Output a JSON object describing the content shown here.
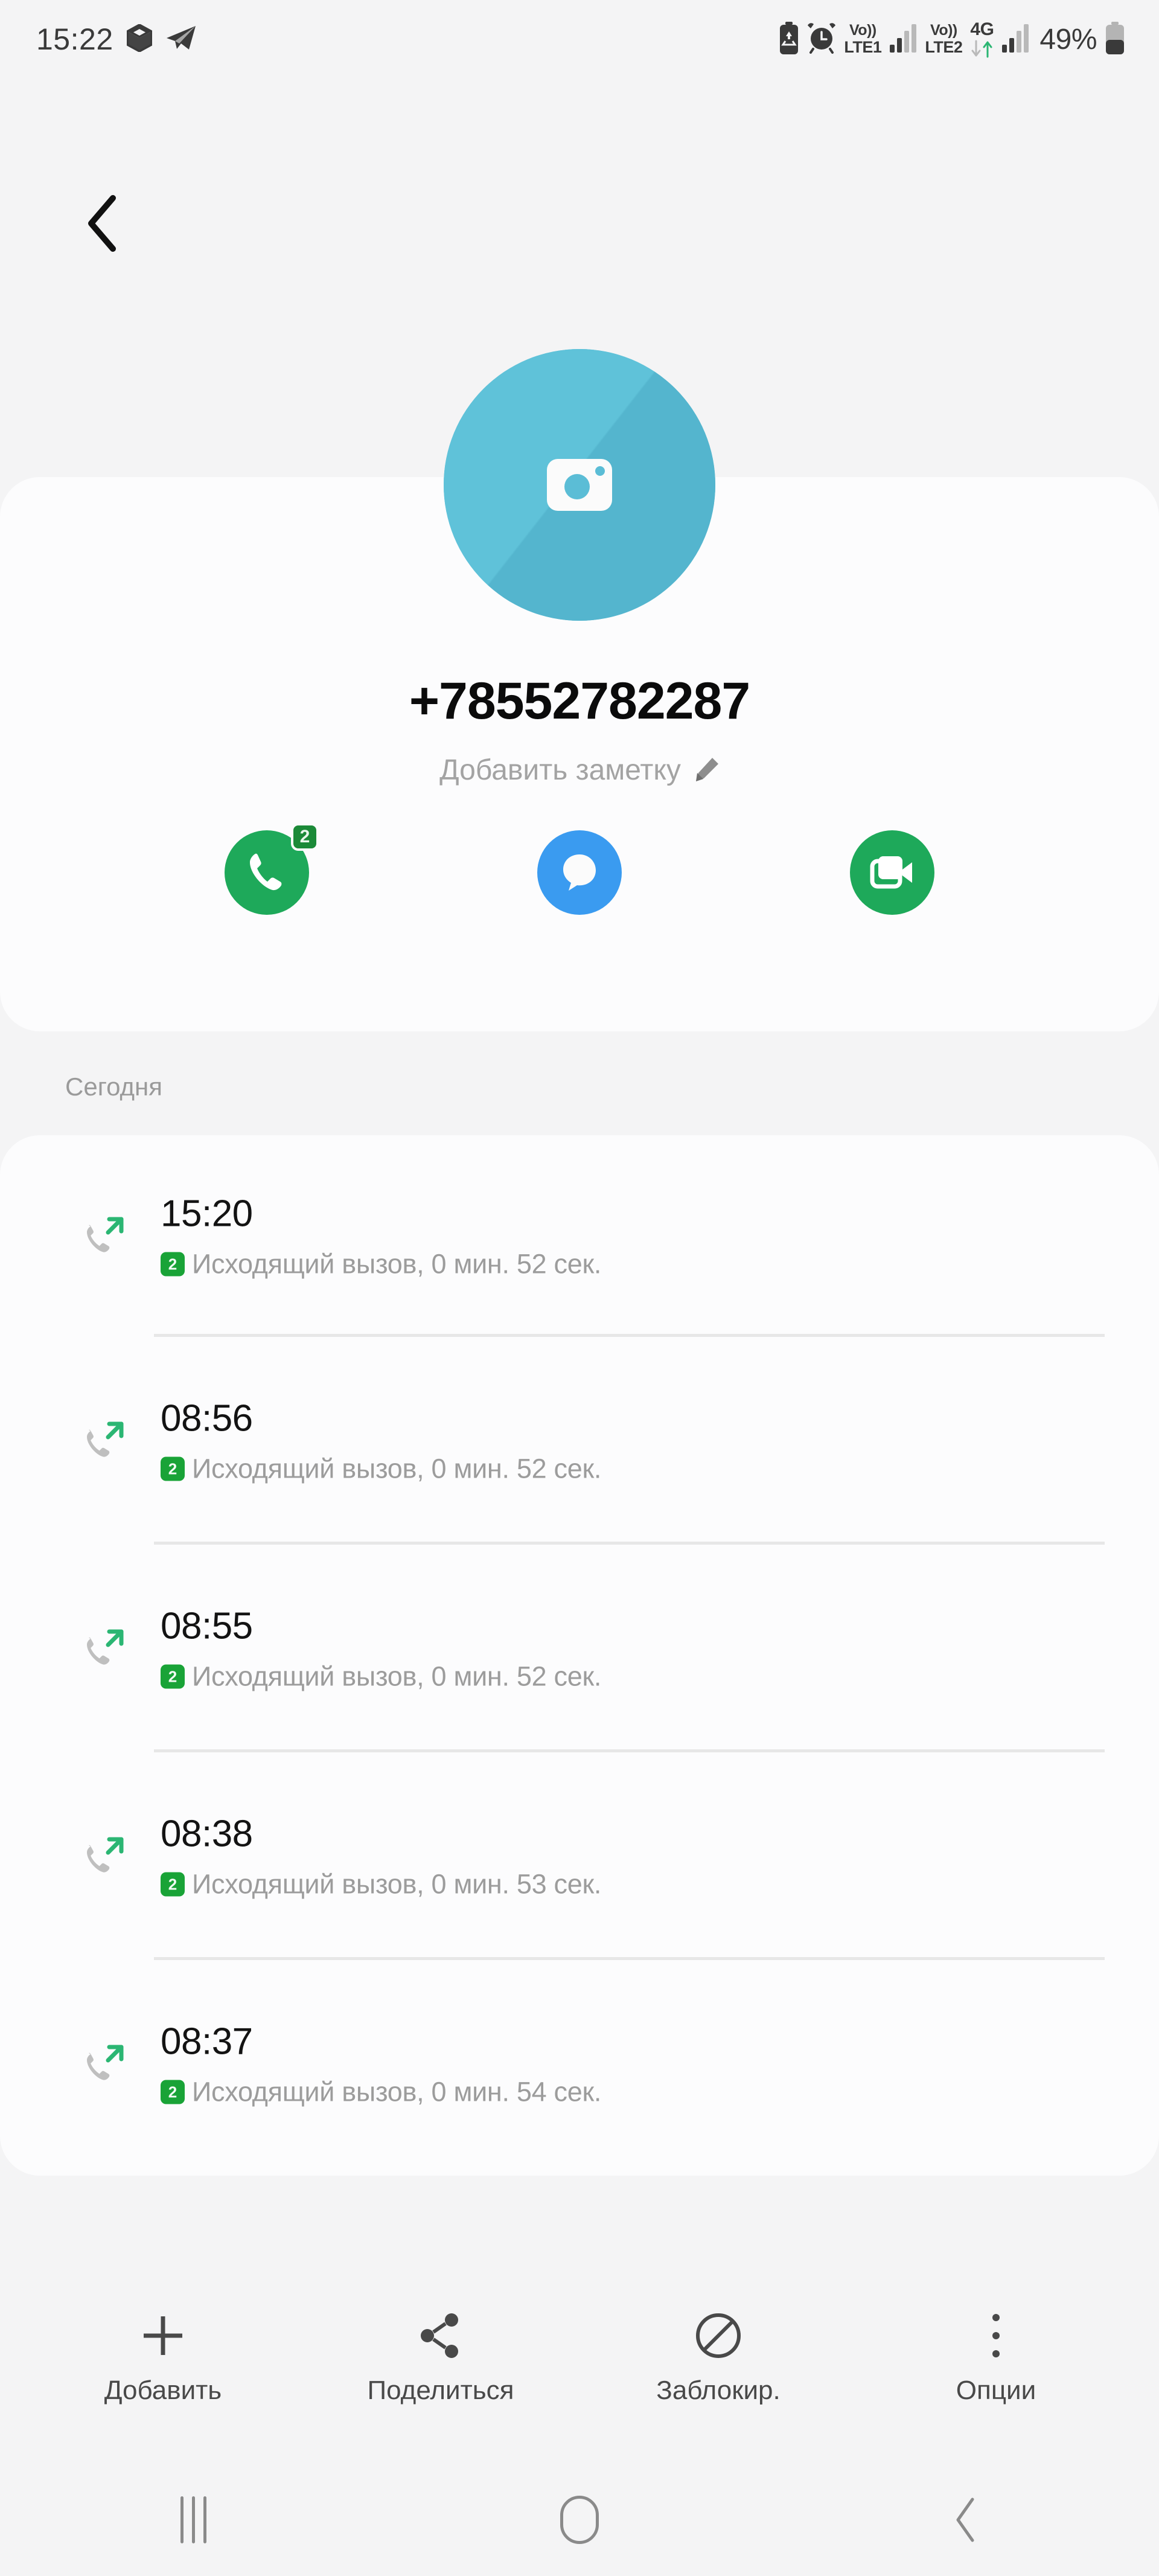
{
  "status_bar": {
    "time": "15:22",
    "left_icons": [
      "package-icon",
      "telegram-icon"
    ],
    "right_icons": [
      "battery-saver-icon",
      "alarm-icon",
      "volte1-icon",
      "signal1-icon",
      "volte2-icon",
      "data-transfer-icon",
      "signal2-icon",
      "battery-icon"
    ],
    "volte1_top": "Vo))",
    "volte1_bottom": "LTE1",
    "volte2_top": "Vo))",
    "volte2_bottom": "LTE2",
    "network_type": "4G",
    "battery_percent": "49%"
  },
  "nav": {
    "back_label": "back-arrow"
  },
  "contact": {
    "avatar_icon": "camera-icon",
    "avatar_color": "#5BBDD6",
    "phone_number": "+78552782287",
    "note_placeholder": "Добавить заметку",
    "note_edit_icon": "pencil-icon"
  },
  "actions": [
    {
      "name": "call",
      "icon": "phone-icon",
      "color": "#1EA95A",
      "badge": "2"
    },
    {
      "name": "message",
      "icon": "message-bubble-icon",
      "color": "#3A9BF0",
      "badge": ""
    },
    {
      "name": "video-call",
      "icon": "video-camera-icon",
      "color": "#1EA95A",
      "badge": ""
    }
  ],
  "call_log": {
    "section_title": "Сегодня",
    "entries": [
      {
        "time": "15:20",
        "sim": "2",
        "description": "Исходящий вызов, 0 мин. 52 сек.",
        "type": "outgoing"
      },
      {
        "time": "08:56",
        "sim": "2",
        "description": "Исходящий вызов, 0 мин. 52 сек.",
        "type": "outgoing"
      },
      {
        "time": "08:55",
        "sim": "2",
        "description": "Исходящий вызов, 0 мин. 52 сек.",
        "type": "outgoing"
      },
      {
        "time": "08:38",
        "sim": "2",
        "description": "Исходящий вызов, 0 мин. 53 сек.",
        "type": "outgoing"
      },
      {
        "time": "08:37",
        "sim": "2",
        "description": "Исходящий вызов, 0 мин. 54 сек.",
        "type": "outgoing"
      }
    ]
  },
  "toolbar": [
    {
      "label": "Добавить",
      "icon": "plus-icon"
    },
    {
      "label": "Поделиться",
      "icon": "share-icon"
    },
    {
      "label": "Заблокир.",
      "icon": "block-icon"
    },
    {
      "label": "Опции",
      "icon": "more-vertical-icon"
    }
  ],
  "navbar": [
    {
      "name": "recents",
      "icon": "recents-icon"
    },
    {
      "name": "home",
      "icon": "home-icon"
    },
    {
      "name": "back",
      "icon": "back-chevron-icon"
    }
  ],
  "colors": {
    "page_bg": "#F4F4F5",
    "card_bg": "#FCFCFD",
    "green": "#1EA95A",
    "blue": "#3A9BF0",
    "outgoing_arrow": "#2BB673",
    "muted_text": "#9C9C9C"
  }
}
